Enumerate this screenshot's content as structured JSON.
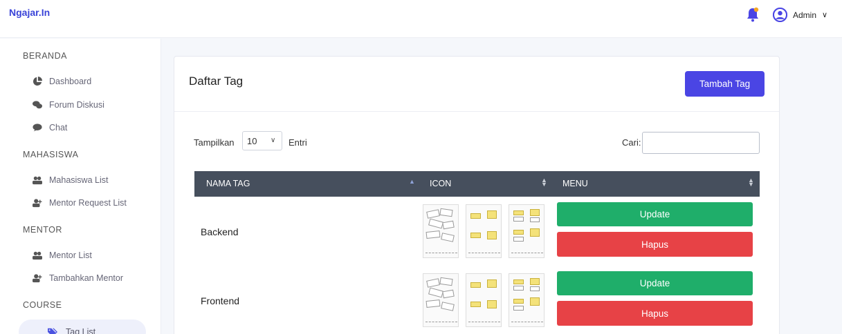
{
  "header": {
    "brand": "Ngajar.In",
    "user_name": "Admin",
    "icons": {
      "notification": "bell-icon",
      "user": "user-circle-icon",
      "dropdown": "chevron-down-icon"
    }
  },
  "sidebar": {
    "sections": [
      {
        "title": "BERANDA",
        "items": [
          {
            "label": "Dashboard",
            "icon": "pie-chart-icon"
          },
          {
            "label": "Forum Diskusi",
            "icon": "comments-icon"
          },
          {
            "label": "Chat",
            "icon": "chat-icon"
          }
        ]
      },
      {
        "title": "MAHASISWA",
        "items": [
          {
            "label": "Mahasiswa List",
            "icon": "users-icon"
          },
          {
            "label": "Mentor Request List",
            "icon": "user-plus-icon"
          }
        ]
      },
      {
        "title": "MENTOR",
        "items": [
          {
            "label": "Mentor List",
            "icon": "users-icon"
          },
          {
            "label": "Tambahkan Mentor",
            "icon": "user-plus-icon"
          }
        ]
      },
      {
        "title": "COURSE",
        "items": [
          {
            "label": "Tag List",
            "icon": "tags-icon",
            "active": true
          }
        ]
      }
    ]
  },
  "main": {
    "title": "Daftar Tag",
    "add_button": "Tambah Tag",
    "show_label": "Tampilkan",
    "page_size": "10",
    "entries_label": "Entri",
    "search_label": "Cari:",
    "search_value": "",
    "table": {
      "columns": [
        "NAMA TAG",
        "ICON",
        "MENU"
      ],
      "rows": [
        {
          "name": "Backend",
          "update": "Update",
          "delete": "Hapus"
        },
        {
          "name": "Frontend",
          "update": "Update",
          "delete": "Hapus"
        }
      ]
    }
  },
  "colors": {
    "accent": "#4a45e4",
    "update": "#1fae6a",
    "delete": "#e74246",
    "table_header": "#464f5d",
    "brand": "#3a44d8"
  }
}
